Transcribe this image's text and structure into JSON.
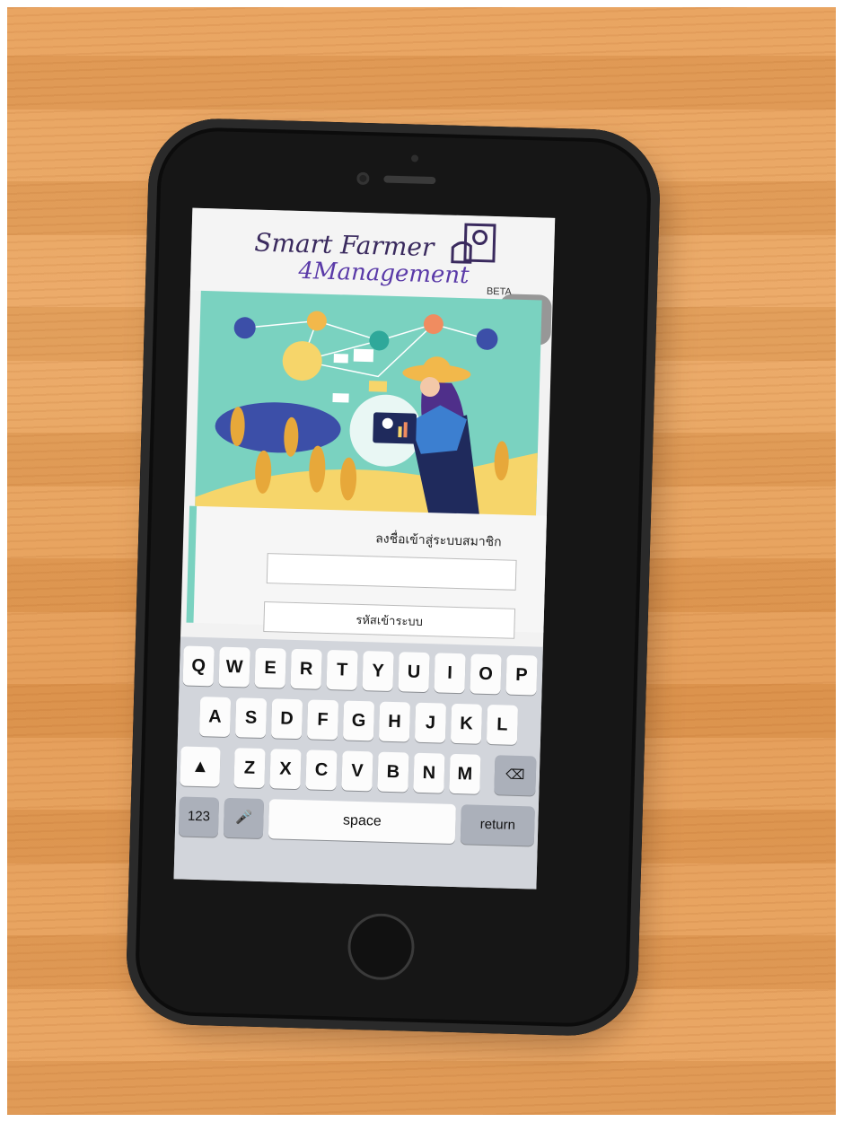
{
  "app": {
    "title_line1": "Smart Farmer",
    "title_line2": "4Management",
    "beta_label": "BETA"
  },
  "login": {
    "title": "ลงชื่อเข้าสู่ระบบสมาชิก",
    "username_placeholder": "",
    "password_placeholder": "รหัสเข้าระบบ"
  },
  "keyboard": {
    "row1": [
      "Q",
      "W",
      "E",
      "R",
      "T",
      "Y",
      "U",
      "I",
      "O",
      "P"
    ],
    "row2": [
      "A",
      "S",
      "D",
      "F",
      "G",
      "H",
      "J",
      "K",
      "L"
    ],
    "row3": [
      "Z",
      "X",
      "C",
      "V",
      "B",
      "N",
      "M"
    ],
    "numbers_key": "123",
    "space_key": "space",
    "return_key": "return"
  },
  "colors": {
    "brand_teal": "#7ad2c0",
    "brand_purple": "#5a3aa8"
  }
}
